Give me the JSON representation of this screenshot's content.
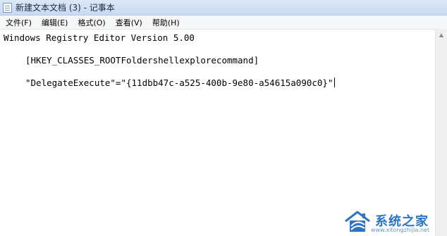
{
  "window": {
    "title": "新建文本文档 (3) - 记事本",
    "app_icon": "notepad-icon"
  },
  "menubar": {
    "items": [
      {
        "label": "文件(F)"
      },
      {
        "label": "编辑(E)"
      },
      {
        "label": "格式(O)"
      },
      {
        "label": "查看(V)"
      },
      {
        "label": "帮助(H)"
      }
    ]
  },
  "document": {
    "lines": [
      "Windows Registry Editor Version 5.00",
      "[HKEY_CLASSES_ROOTFoldershellexplorecommand]",
      "\"DelegateExecute\"=\"{11dbb47c-a525-400b-9e80-a54615a090c0}\""
    ]
  },
  "scrollbar": {
    "up_arrow": "▲"
  },
  "watermark": {
    "name": "系统之家",
    "url": "www.xitongzhijia.net",
    "brand_color": "#2e74c4"
  }
}
